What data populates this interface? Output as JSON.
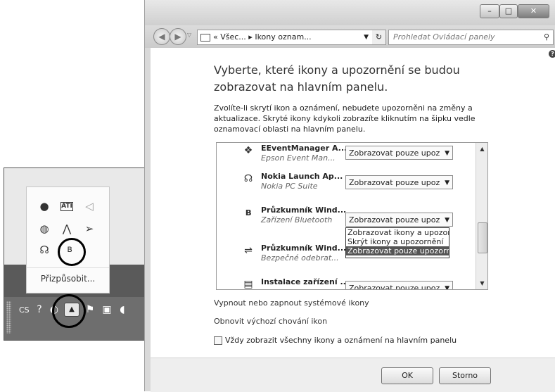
{
  "tray": {
    "customize_label": "Přizpůsobit...",
    "language": "CS",
    "icons": [
      "globe-icon",
      "ati-icon",
      "network-icon",
      "shield-icon",
      "antenna-icon",
      "wing-icon",
      "nokia-icon",
      "bluetooth-icon"
    ]
  },
  "window": {
    "address": {
      "prefix": "«",
      "part1": "Všec...",
      "separator": "▸",
      "part2": "Ikony oznam..."
    },
    "search_placeholder": "Prohledat Ovládací panely",
    "heading": "Vyberte, které ikony a upozornění se budou zobrazovat na hlavním panelu.",
    "description": "Zvolíte-li skrytí ikon a oznámení, nebudete upozorněni na změny a aktualizace. Skryté ikony kdykoli zobrazíte kliknutím na šipku vedle oznamovací oblasti na hlavním panelu.",
    "rows": [
      {
        "name": "EEventManager A...",
        "sub": "Epson Event Man...",
        "value": "Zobrazovat pouze upoz"
      },
      {
        "name": "Nokia Launch Ap...",
        "sub": "Nokia PC Suite",
        "value": "Zobrazovat pouze upoz"
      },
      {
        "name": "Průzkumník Wind...",
        "sub": "Zařízení Bluetooth",
        "value": "Zobrazovat pouze upoz"
      },
      {
        "name": "Průzkumník Wind...",
        "sub": "Bezpečné odebrat...",
        "value": ""
      },
      {
        "name": "Instalace zařízení ...",
        "sub": "",
        "value": "Zobrazovat pouze upoz"
      }
    ],
    "dropdown_options": [
      "Zobrazovat ikony a upozorn",
      "Skrýt ikony a upozornění",
      "Zobrazovat pouze upozorn"
    ],
    "link_system_icons": "Vypnout nebo zapnout systémové ikony",
    "link_restore": "Obnovit výchozí chování ikon",
    "always_show_label": "Vždy zobrazit všechny ikony a oznámení na hlavním panelu",
    "ok_label": "OK",
    "cancel_label": "Storno"
  }
}
